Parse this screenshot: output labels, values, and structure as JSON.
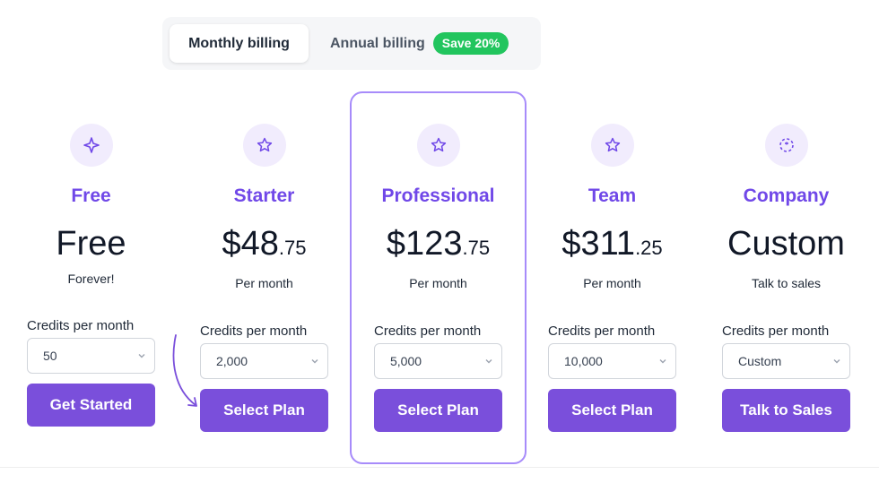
{
  "billing": {
    "monthly_label": "Monthly billing",
    "annual_label": "Annual billing",
    "save_badge": "Save 20%"
  },
  "colors": {
    "accent": "#7048e8",
    "button": "#7a4fdb",
    "badge": "#22c55e",
    "highlight_border": "#a78bfa"
  },
  "plans": [
    {
      "icon": "sparkle-icon",
      "name": "Free",
      "price_main": "Free",
      "price_cents": "",
      "subtext": "Forever!",
      "credits_label": "Credits per month",
      "credits_value": "50",
      "cta": "Get Started",
      "highlighted": false
    },
    {
      "icon": "star-icon",
      "name": "Starter",
      "price_main": "$48",
      "price_cents": ".75",
      "subtext": "Per month",
      "credits_label": "Credits per month",
      "credits_value": "2,000",
      "cta": "Select Plan",
      "highlighted": false
    },
    {
      "icon": "star-icon",
      "name": "Professional",
      "price_main": "$123",
      "price_cents": ".75",
      "subtext": "Per month",
      "credits_label": "Credits per month",
      "credits_value": "5,000",
      "cta": "Select Plan",
      "highlighted": true
    },
    {
      "icon": "star-icon",
      "name": "Team",
      "price_main": "$311",
      "price_cents": ".25",
      "subtext": "Per month",
      "credits_label": "Credits per month",
      "credits_value": "10,000",
      "cta": "Select Plan",
      "highlighted": false
    },
    {
      "icon": "dashed-circle-icon",
      "name": "Company",
      "price_main": "Custom",
      "price_cents": "",
      "subtext": "Talk to sales",
      "credits_label": "Credits per month",
      "credits_value": "Custom",
      "cta": "Talk to Sales",
      "highlighted": false
    }
  ]
}
